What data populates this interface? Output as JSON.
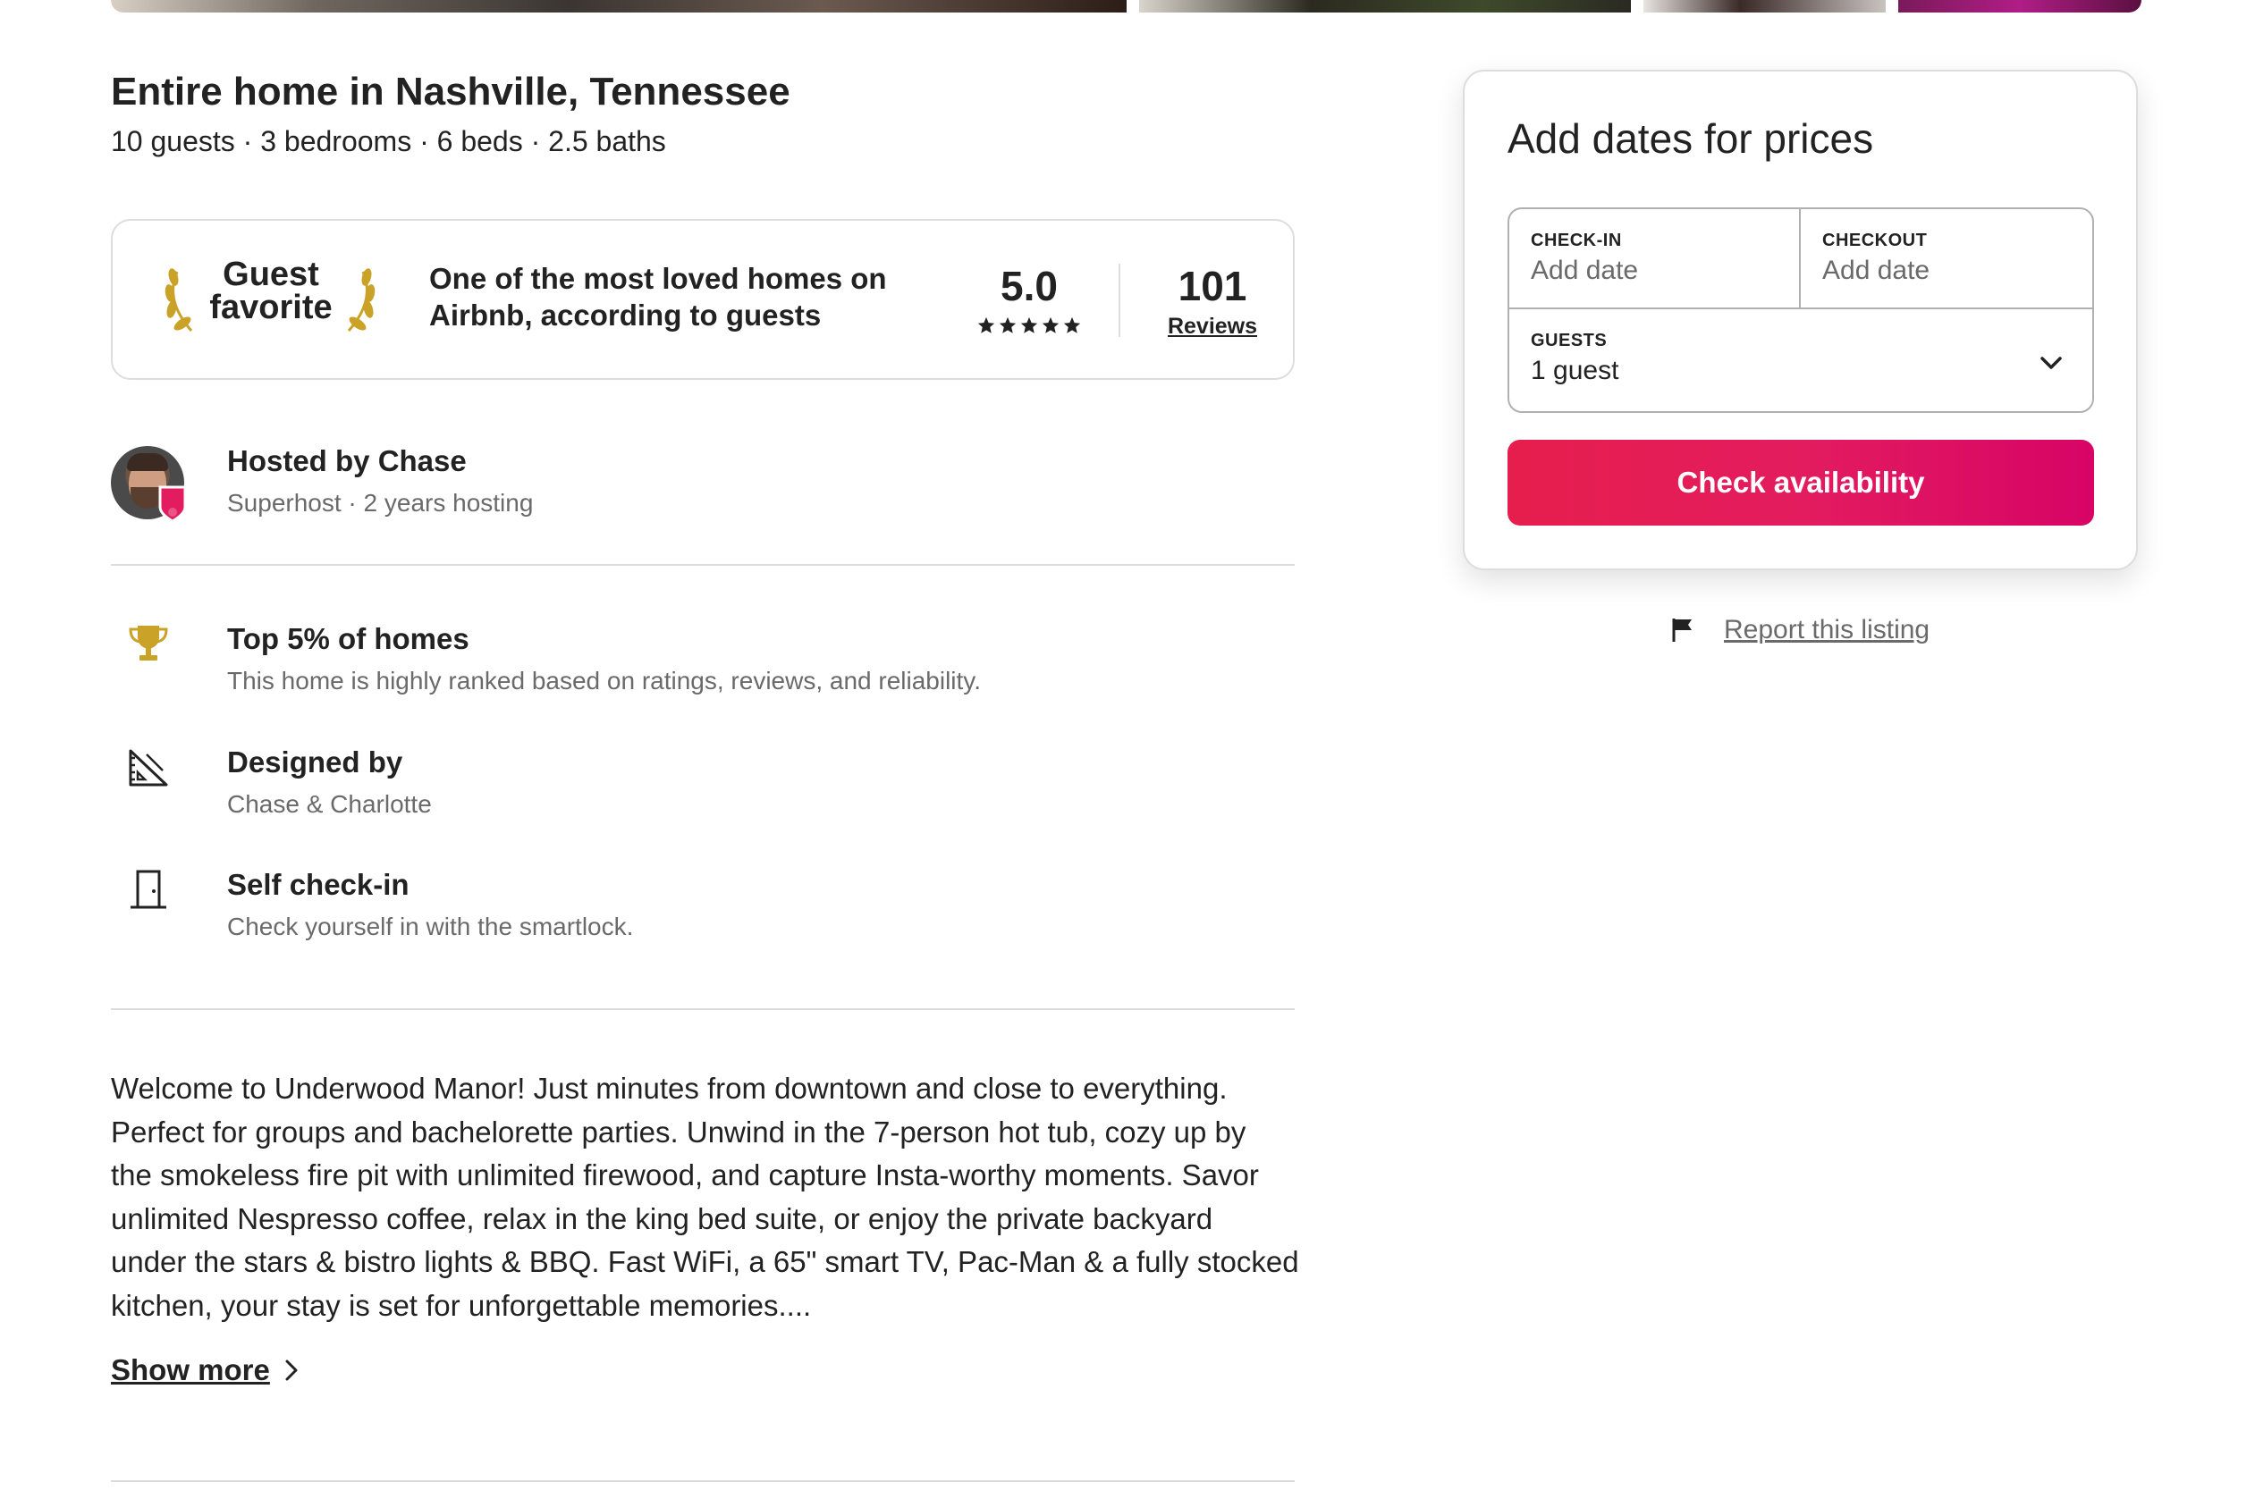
{
  "listing": {
    "title": "Entire home in Nashville, Tennessee",
    "subtitle": "10 guests · 3 bedrooms · 6 beds · 2.5 baths"
  },
  "guest_favorite": {
    "label_line1": "Guest",
    "label_line2": "favorite",
    "text_line1": "One of the most loved homes on",
    "text_line2": "Airbnb, according to guests",
    "rating": "5.0",
    "stars": 5,
    "reviews_count": "101",
    "reviews_label": "Reviews"
  },
  "host": {
    "name": "Hosted by Chase",
    "meta": "Superhost · 2 years hosting"
  },
  "highlights": [
    {
      "icon": "trophy-icon",
      "title": "Top 5% of homes",
      "desc": "This home is highly ranked based on ratings, reviews, and reliability."
    },
    {
      "icon": "design-ruler-icon",
      "title": "Designed by",
      "desc": "Chase & Charlotte"
    },
    {
      "icon": "door-icon",
      "title": "Self check-in",
      "desc": "Check yourself in with the smartlock."
    }
  ],
  "description": {
    "text": "Welcome to Underwood Manor! Just minutes from downtown and close to everything.\nPerfect for groups and bachelorette parties. Unwind in the 7-person hot tub, cozy up by\nthe smokeless fire pit with unlimited firewood, and capture Insta-worthy moments. Savor\nunlimited Nespresso coffee, relax in the king bed suite, or enjoy the private backyard\nunder the stars & bistro lights & BBQ. Fast WiFi, a 65\" smart TV,  Pac-Man & a fully stocked\nkitchen, your stay is set for unforgettable memories....",
    "show_more": "Show more"
  },
  "booking": {
    "title": "Add dates for prices",
    "checkin_label": "CHECK-IN",
    "checkin_value": "Add date",
    "checkout_label": "CHECKOUT",
    "checkout_value": "Add date",
    "guests_label": "GUESTS",
    "guests_value": "1 guest",
    "cta": "Check availability"
  },
  "report": {
    "label": "Report this listing"
  },
  "colors": {
    "brand": "#e31c5f",
    "text": "#222222",
    "muted": "#6a6a6a",
    "border": "#dddddd",
    "gold": "#c9a227"
  }
}
